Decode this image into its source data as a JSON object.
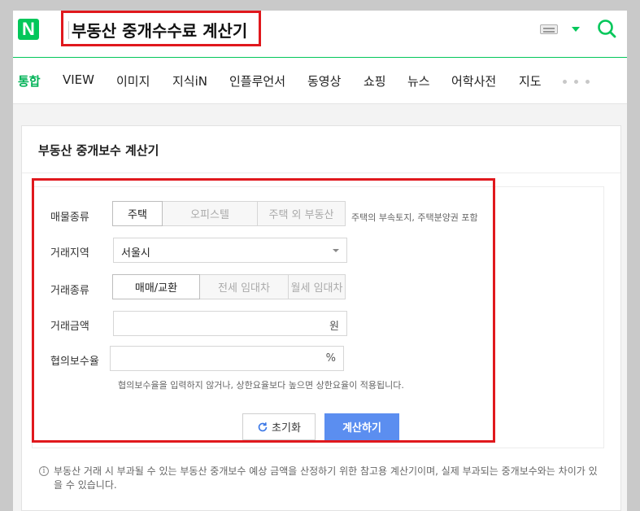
{
  "header": {
    "logo_letter": "N",
    "title": "부동산 중개수수료 계산기",
    "brand_color": "#03c75a",
    "highlight_color": "#e0181d"
  },
  "tabs": [
    {
      "label": "통합",
      "active": true
    },
    {
      "label": "VIEW"
    },
    {
      "label": "이미지"
    },
    {
      "label": "지식iN"
    },
    {
      "label": "인플루언서"
    },
    {
      "label": "동영상"
    },
    {
      "label": "쇼핑"
    },
    {
      "label": "뉴스"
    },
    {
      "label": "어학사전"
    },
    {
      "label": "지도"
    }
  ],
  "calculator": {
    "title": "부동산 중개보수 계산기",
    "property_type": {
      "label": "매물종류",
      "options": [
        "주택",
        "오피스텔",
        "주택 외 부동산"
      ],
      "selected": "주택",
      "hint": "주택의 부속토지, 주택분양권 포함"
    },
    "region": {
      "label": "거래지역",
      "selected": "서울시"
    },
    "deal_type": {
      "label": "거래종류",
      "options": [
        "매매/교환",
        "전세 임대차",
        "월세 임대차"
      ],
      "selected": "매매/교환"
    },
    "amount": {
      "label": "거래금액",
      "value": "",
      "unit": "원"
    },
    "rate": {
      "label": "협의보수율",
      "value": "",
      "unit": "%",
      "hint": "협의보수율을 입력하지 않거나, 상한요율보다 높으면 상한요율이 적용됩니다."
    },
    "reset_label": "초기화",
    "calc_label": "계산하기",
    "button_color": "#5b8ef0"
  },
  "notice": "부동산 거래 시 부과될 수 있는 부동산 중개보수 예상 금액을 산정하기 위한 참고용 계산기이며, 실제 부과되는 중개보수와는 차이가 있을 수 있습니다."
}
